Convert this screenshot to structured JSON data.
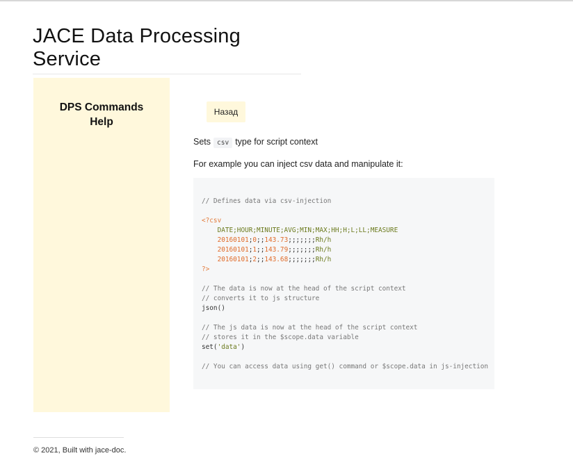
{
  "header": {
    "title": "JACE Data Processing Service"
  },
  "sidebar": {
    "title": "DPS Commands Help"
  },
  "content": {
    "back_label": "Назад",
    "desc_prefix": "Sets",
    "desc_code": "csv",
    "desc_suffix": "type for script context",
    "example_intro": "For example you can inject csv data and manipulate it:",
    "code": {
      "comment1": "// Defines data via csv-injection",
      "open_tag": "<?csv",
      "csv_header": "DATE;HOUR;MINUTE;AVG;MIN;MAX;HH;H;L;LL;MEASURE",
      "rows": [
        {
          "a": "20160101",
          "b": "0",
          "c": "143.73",
          "unit": "Rh/h"
        },
        {
          "a": "20160101",
          "b": "1",
          "c": "143.79",
          "unit": "Rh/h"
        },
        {
          "a": "20160101",
          "b": "2",
          "c": "143.68",
          "unit": "Rh/h"
        }
      ],
      "close_tag": "?>",
      "comment2": "// The data is now at the head of the script context",
      "comment3": "// converts it to js structure",
      "json_call": "json()",
      "comment4": "// The js data is now at the head of the script context",
      "comment5": "// stores it in the $scope.data variable",
      "set_fn": "set(",
      "set_arg": "'data'",
      "set_close": ")",
      "comment6": "// You can access data using get() command or $scope.data in js-injection"
    }
  },
  "footer": {
    "text": "© 2021, Built with jace-doc."
  },
  "colors": {
    "sidebar_bg": "#fff8dc",
    "code_bg": "#f6f7f8",
    "tag": "#e37b3b",
    "string": "#6b7a1d"
  }
}
